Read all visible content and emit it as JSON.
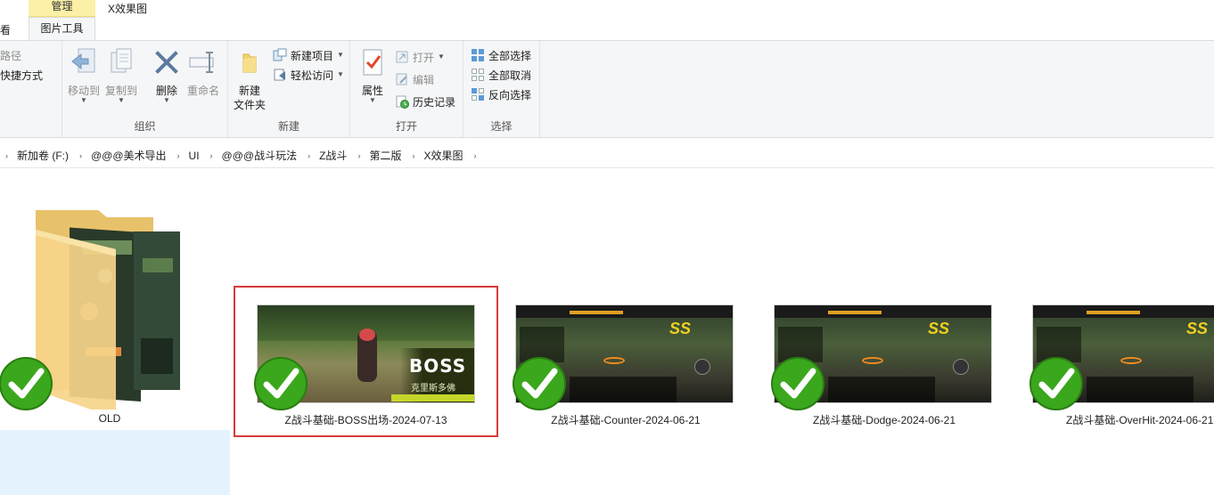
{
  "tabs": {
    "view_partial": "查看",
    "picture_tools": "图片工具",
    "context_manage": "管理",
    "window_title": "X效果图"
  },
  "ribbon": {
    "clipboard": {
      "copy_path": "制路径",
      "paste_shortcut": "贴快捷方式"
    },
    "organize": {
      "label": "组织",
      "move_to": "移动到",
      "copy_to": "复制到",
      "delete": "删除",
      "rename": "重命名"
    },
    "new": {
      "label": "新建",
      "new_folder_line1": "新建",
      "new_folder_line2": "文件夹",
      "new_item": "新建项目",
      "easy_access": "轻松访问"
    },
    "open": {
      "label": "打开",
      "properties": "属性",
      "open": "打开",
      "edit": "编辑",
      "history": "历史记录"
    },
    "select": {
      "label": "选择",
      "select_all": "全部选择",
      "select_none": "全部取消",
      "invert": "反向选择"
    }
  },
  "breadcrumb": [
    "新加卷 (F:)",
    "@@@美术导出",
    "UI",
    "@@@战斗玩法",
    "Z战斗",
    "第二版",
    "X效果图"
  ],
  "files": [
    {
      "name": "OLD",
      "type": "folder",
      "status_icon": "green-check-icon"
    },
    {
      "name": "Z战斗基础-BOSS出场-2024-07-13",
      "type": "image",
      "status_icon": "green-check-icon",
      "thumb_text": "BOSS",
      "thumb_caption": "克里斯多佛"
    },
    {
      "name": "Z战斗基础-Counter-2024-06-21",
      "type": "image",
      "status_icon": "green-check-icon",
      "thumb_text": "SS"
    },
    {
      "name": "Z战斗基础-Dodge-2024-06-21",
      "type": "image",
      "status_icon": "green-check-icon",
      "thumb_text": "SS"
    },
    {
      "name": "Z战斗基础-OverHit-2024-06-21",
      "type": "image",
      "status_icon": "green-check-icon",
      "thumb_text": "SS"
    }
  ],
  "colors": {
    "context_tab": "#fbf0a6",
    "ribbon_bg": "#f5f6f7",
    "selection_bg": "#e5f3ff",
    "highlight_border": "#d63b3b",
    "check_green": "#3aa71c"
  }
}
